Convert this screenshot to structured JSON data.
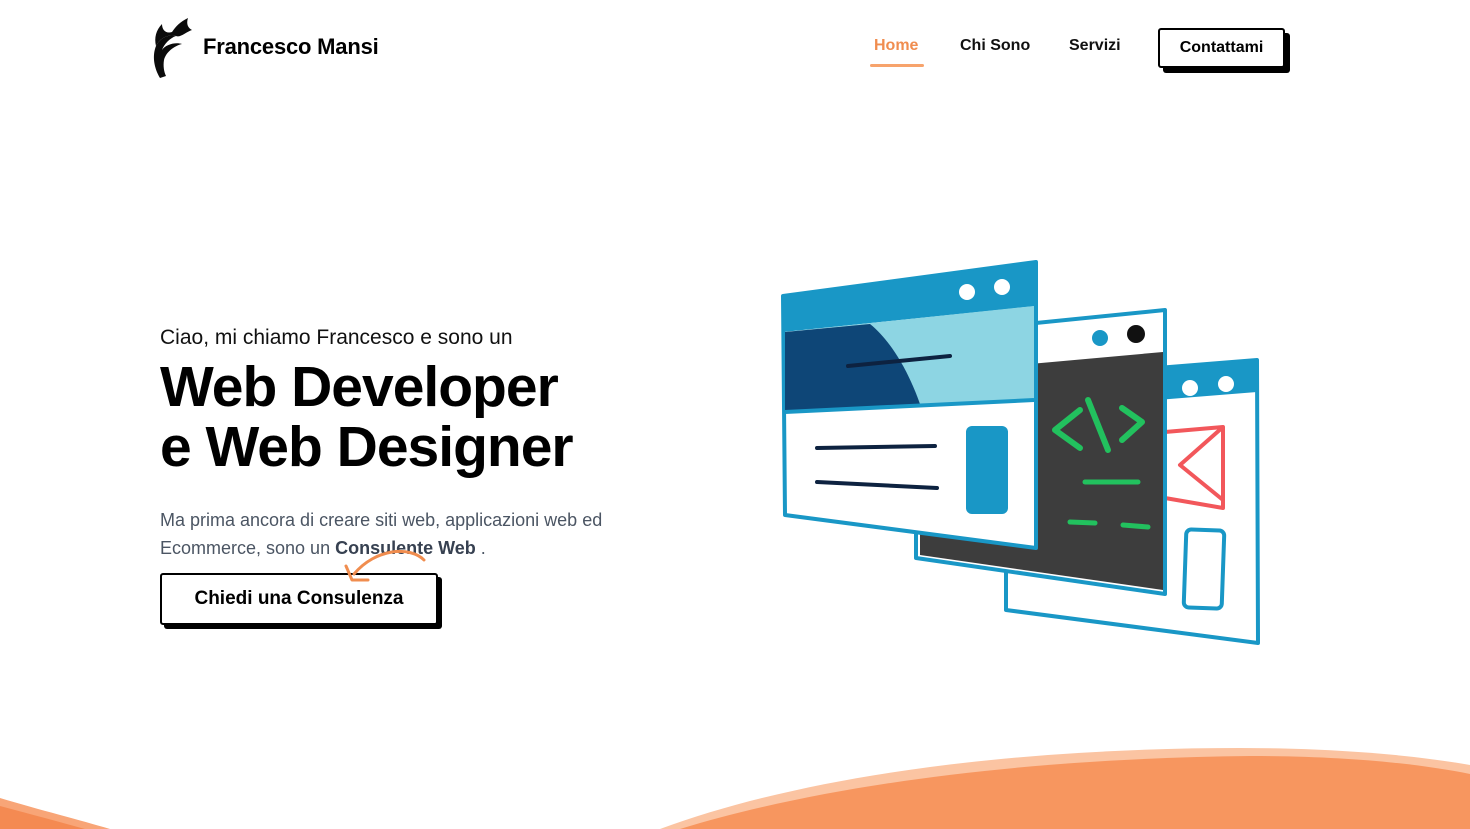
{
  "header": {
    "brand_name": "Francesco Mansi",
    "nav": {
      "home": "Home",
      "about": "Chi Sono",
      "services": "Servizi"
    },
    "contact_label": "Contattami"
  },
  "hero": {
    "intro": "Ciao, mi chiamo Francesco e sono un",
    "title_line1": "Web Developer",
    "title_line2": "e Web Designer",
    "desc_part1": "Ma prima ancora di creare siti web, applicazioni web ed Ecommerce, sono un ",
    "desc_highlight": "Consulente Web",
    "desc_part2": " .",
    "cta_label": "Chiedi una Consulenza"
  },
  "colors": {
    "accent_orange": "#f08d4f",
    "wave_orange": "#f7965f",
    "illustration_blue": "#1997c6",
    "code_green": "#22c15e"
  },
  "icons": [
    "flame-logo-icon",
    "curved-arrow-icon",
    "browser-windows-illustration"
  ]
}
